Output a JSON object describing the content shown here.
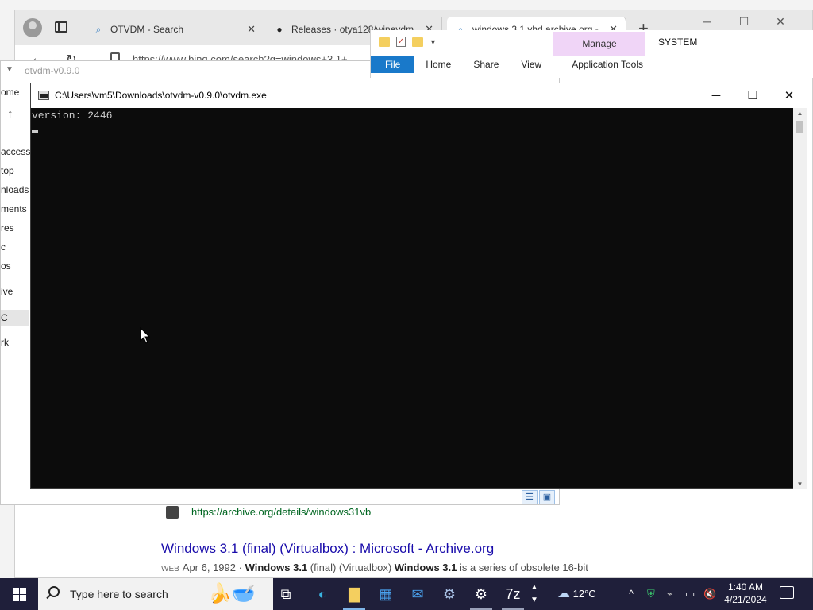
{
  "browser": {
    "tabs": [
      {
        "label": "OTVDM - Search",
        "icon": "search-icon"
      },
      {
        "label": "Releases · otya128/winevdm",
        "icon": "github-icon"
      },
      {
        "label": "windows 3.1 vhd archive.org -",
        "icon": "search-icon"
      }
    ],
    "url": "https://www.bing.com/search?q=windows+3.1+",
    "result": {
      "link": "https://archive.org/details/windows31vb",
      "title": "Windows 3.1 (final) (Virtualbox) : Microsoft - Archive.org",
      "web_tag": "WEB",
      "snippet_date": "Apr 6, 1992 · ",
      "snippet_bold1": "Windows 3.1",
      "snippet_mid": " (final) (Virtualbox) ",
      "snippet_bold2": "Windows 3.1",
      "snippet_end": " is a series of obsolete 16-bit"
    }
  },
  "explorer": {
    "title": "otvdm-v0.9.0",
    "home_label": "ome",
    "nav_items": [
      "access",
      "top",
      "nloads",
      "ments",
      "res",
      "c",
      "os",
      "ive",
      "C",
      "rk"
    ]
  },
  "ribbon": {
    "manage": "Manage",
    "system": "SYSTEM",
    "tabs": [
      "File",
      "Home",
      "Share",
      "View",
      "Application Tools"
    ]
  },
  "console": {
    "title": "C:\\Users\\vm5\\Downloads\\otvdm-v0.9.0\\otvdm.exe",
    "output": "version: 2446",
    "minimize": "─",
    "maximize": "☐",
    "close": "✕"
  },
  "taskbar": {
    "search_placeholder": "Type here to search",
    "weather": "12°C",
    "time": "1:40 AM",
    "date": "4/21/2024"
  },
  "colors": {
    "console_bg": "#0c0c0c",
    "console_text": "#cccccc",
    "taskbar_bg": "#1f1f3a",
    "ribbon_file": "#1979ca",
    "manage_bg": "#f0d5f7",
    "link_title": "#1a0dab",
    "link_url": "#006621"
  }
}
